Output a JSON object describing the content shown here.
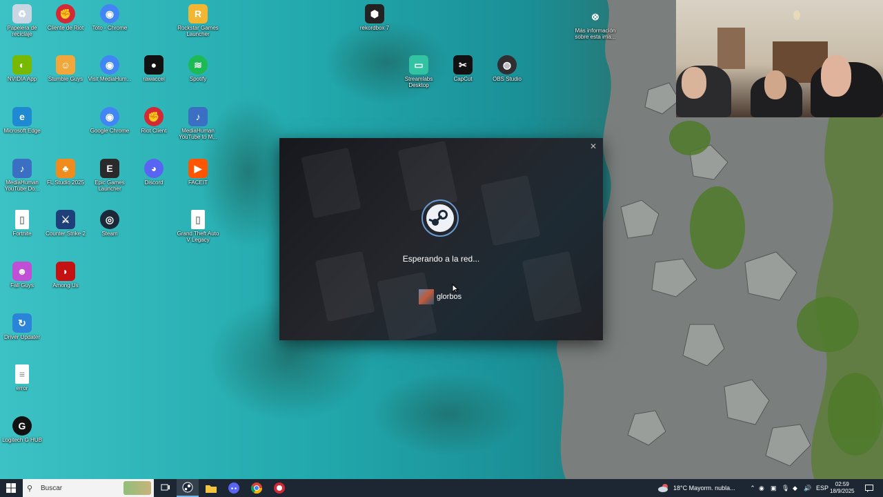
{
  "desktop_icons": [
    {
      "label": "Papelera de reciclaje",
      "icon": "recycle-bin-icon"
    },
    {
      "label": "Cliente de Riot",
      "icon": "riot-client-icon"
    },
    {
      "label": "Toto - Chrome",
      "icon": "chrome-icon"
    },
    {
      "label": "Rockstar Games Launcher",
      "icon": "rockstar-icon"
    },
    {
      "label": "rekordbox 7",
      "icon": "rekordbox-icon"
    },
    {
      "label": "Más información sobre esta ima...",
      "icon": "spotlight-info-icon"
    },
    {
      "label": "NVIDIA App",
      "icon": "nvidia-icon"
    },
    {
      "label": "Stumble Guys",
      "icon": "stumble-guys-icon"
    },
    {
      "label": "Visit MediaHum...",
      "icon": "chrome-icon"
    },
    {
      "label": "rawaccel",
      "icon": "rawaccel-icon"
    },
    {
      "label": "Spotify",
      "icon": "spotify-icon"
    },
    {
      "label": "Streamlabs Desktop",
      "icon": "streamlabs-icon"
    },
    {
      "label": "CapCut",
      "icon": "capcut-icon"
    },
    {
      "label": "OBS Studio",
      "icon": "obs-icon"
    },
    {
      "label": "Microsoft Edge",
      "icon": "edge-icon"
    },
    {
      "label": "Google Chrome",
      "icon": "chrome-icon"
    },
    {
      "label": "Riot Client",
      "icon": "riot-client-icon"
    },
    {
      "label": "MediaHuman YouTube to M...",
      "icon": "mediahuman-icon"
    },
    {
      "label": "MediaHuman YouTube Do...",
      "icon": "mediahuman-icon"
    },
    {
      "label": "FL Studio 2025",
      "icon": "fl-studio-icon"
    },
    {
      "label": "Epic Games Launcher",
      "icon": "epic-games-icon"
    },
    {
      "label": "Discord",
      "icon": "discord-icon"
    },
    {
      "label": "FACEIT",
      "icon": "faceit-icon"
    },
    {
      "label": "Fortnite",
      "icon": "file-icon"
    },
    {
      "label": "Counter Strike 2",
      "icon": "cs2-icon"
    },
    {
      "label": "Steam",
      "icon": "steam-icon"
    },
    {
      "label": "Grand Theft Auto V Legacy",
      "icon": "file-icon"
    },
    {
      "label": "Fall Guys",
      "icon": "fall-guys-icon"
    },
    {
      "label": "Among Us",
      "icon": "among-us-icon"
    },
    {
      "label": "Driver Updater",
      "icon": "driver-updater-icon"
    },
    {
      "label": "error",
      "icon": "text-file-icon"
    },
    {
      "label": "Logitech G HUB",
      "icon": "logitech-icon"
    }
  ],
  "steam_dialog": {
    "status": "Esperando a la red...",
    "username": "glorbos",
    "close_glyph": "✕"
  },
  "taskbar": {
    "search_placeholder": "Buscar",
    "weather": "18°C  Mayorm. nubla...",
    "language": "ESP",
    "time": "02:59",
    "date": "18/9/2025"
  },
  "colors": {
    "taskbar_bg": "#1c2733",
    "steam_accent": "#6eaae6",
    "sea": "#2aa7a7"
  }
}
